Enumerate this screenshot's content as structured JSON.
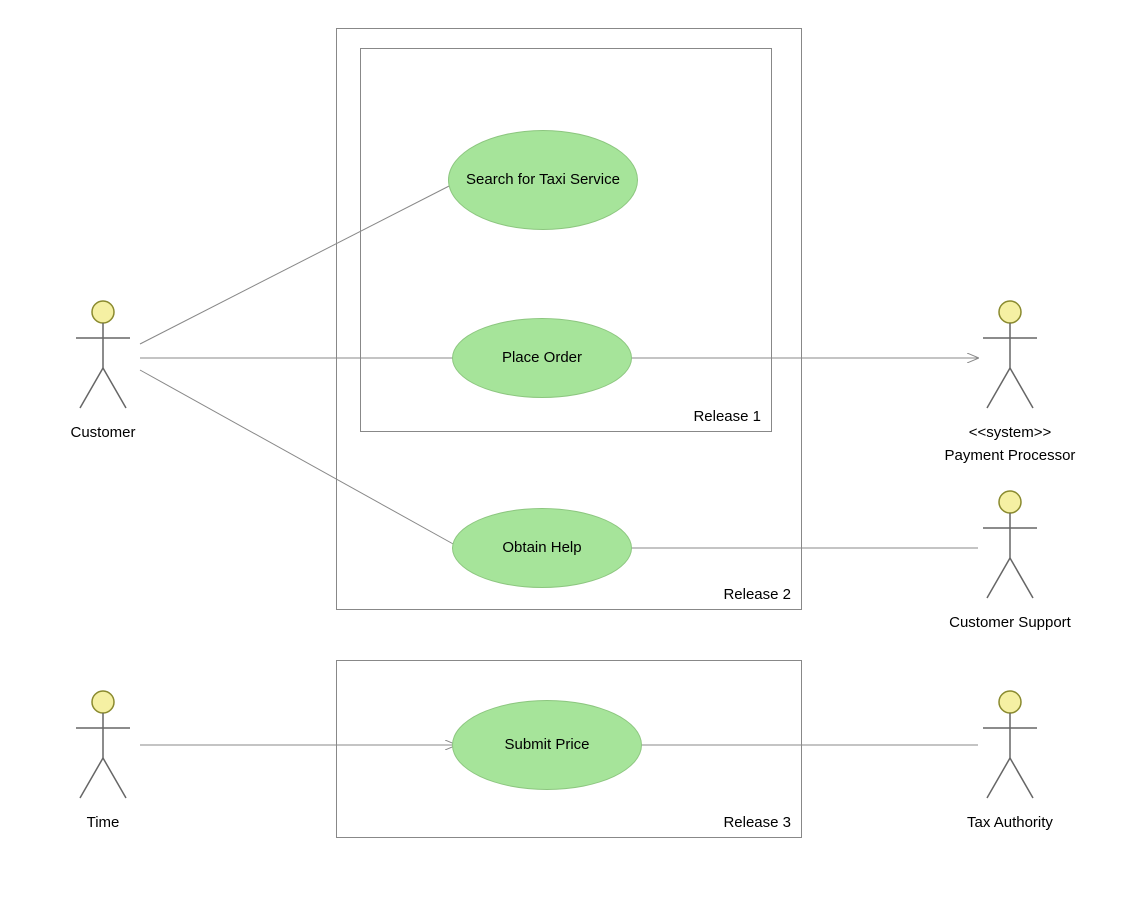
{
  "colors": {
    "usecase_fill": "#a6e49a",
    "usecase_stroke": "#8cc67f",
    "actor_head_fill": "#f5f0a3",
    "actor_stroke": "#8a8a2e",
    "line": "#888888",
    "boundary": "#888888"
  },
  "actors": {
    "customer": {
      "label": "Customer"
    },
    "time": {
      "label": "Time"
    },
    "payment_processor": {
      "label": "Payment Processor",
      "stereotype": "<<system>>"
    },
    "customer_support": {
      "label": "Customer Support"
    },
    "tax_authority": {
      "label": "Tax Authority"
    }
  },
  "boundaries": {
    "release1": {
      "label": "Release 1"
    },
    "release2": {
      "label": "Release 2"
    },
    "release3": {
      "label": "Release 3"
    }
  },
  "usecases": {
    "search_taxi": {
      "label": "Search for Taxi Service"
    },
    "place_order": {
      "label": "Place Order"
    },
    "obtain_help": {
      "label": "Obtain Help"
    },
    "submit_price": {
      "label": "Submit Price"
    }
  },
  "connectors": [
    {
      "from": "customer",
      "to": "search_taxi",
      "arrow": false
    },
    {
      "from": "customer",
      "to": "place_order",
      "arrow": false
    },
    {
      "from": "customer",
      "to": "obtain_help",
      "arrow": false
    },
    {
      "from": "place_order",
      "to": "payment_processor",
      "arrow": true
    },
    {
      "from": "obtain_help",
      "to": "customer_support",
      "arrow": false
    },
    {
      "from": "time",
      "to": "submit_price",
      "arrow": true
    },
    {
      "from": "submit_price",
      "to": "tax_authority",
      "arrow": false
    }
  ]
}
